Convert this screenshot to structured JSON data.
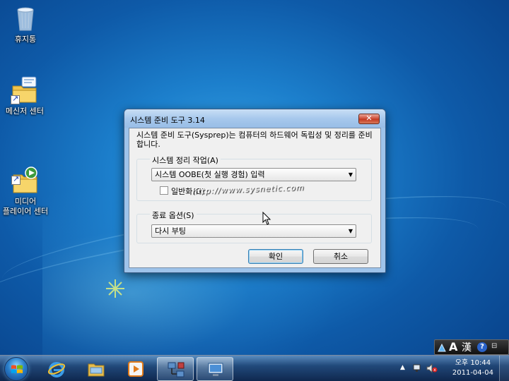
{
  "desktop": {
    "icons": [
      {
        "label": "휴지통",
        "icon": "recycle-bin-icon"
      },
      {
        "label": "메신저 센터",
        "icon": "messenger-center-icon"
      },
      {
        "label": "미디어\n플레이어 센터",
        "icon": "media-player-center-icon"
      }
    ]
  },
  "dialog": {
    "title": "시스템 준비 도구 3.14",
    "close_label": "✕",
    "description": "시스템 준비 도구(Sysprep)는 컴퓨터의 하드웨어 독립성 및 정리를 준비합니다.",
    "cleanup_group": {
      "label": "시스템 정리 작업(A)",
      "selected": "시스템 OOBE(첫 실행 경험) 입력",
      "generalize_label": "일반화(G)",
      "generalize_checked": false
    },
    "shutdown_group": {
      "label": "종료 옵션(S)",
      "selected": "다시 부팅"
    },
    "ok_label": "확인",
    "cancel_label": "취소"
  },
  "watermark": "http://www.sysnetic.com",
  "taskbar": {
    "pinned": [
      {
        "name": "internet-explorer",
        "icon": "internet-explorer-icon"
      },
      {
        "name": "file-explorer",
        "icon": "folder-icon"
      },
      {
        "name": "media-player",
        "icon": "media-player-icon"
      },
      {
        "name": "network-app",
        "icon": "network-computers-icon"
      },
      {
        "name": "sysprep-app",
        "icon": "sysprep-icon"
      }
    ],
    "language_bar": {
      "input_mode": "A",
      "hanja": "漢",
      "help": "?"
    },
    "clock": {
      "time": "오후 10:44",
      "date": "2011-04-04"
    }
  },
  "colors": {
    "accent": "#1c7fcc",
    "close": "#c33a22"
  }
}
